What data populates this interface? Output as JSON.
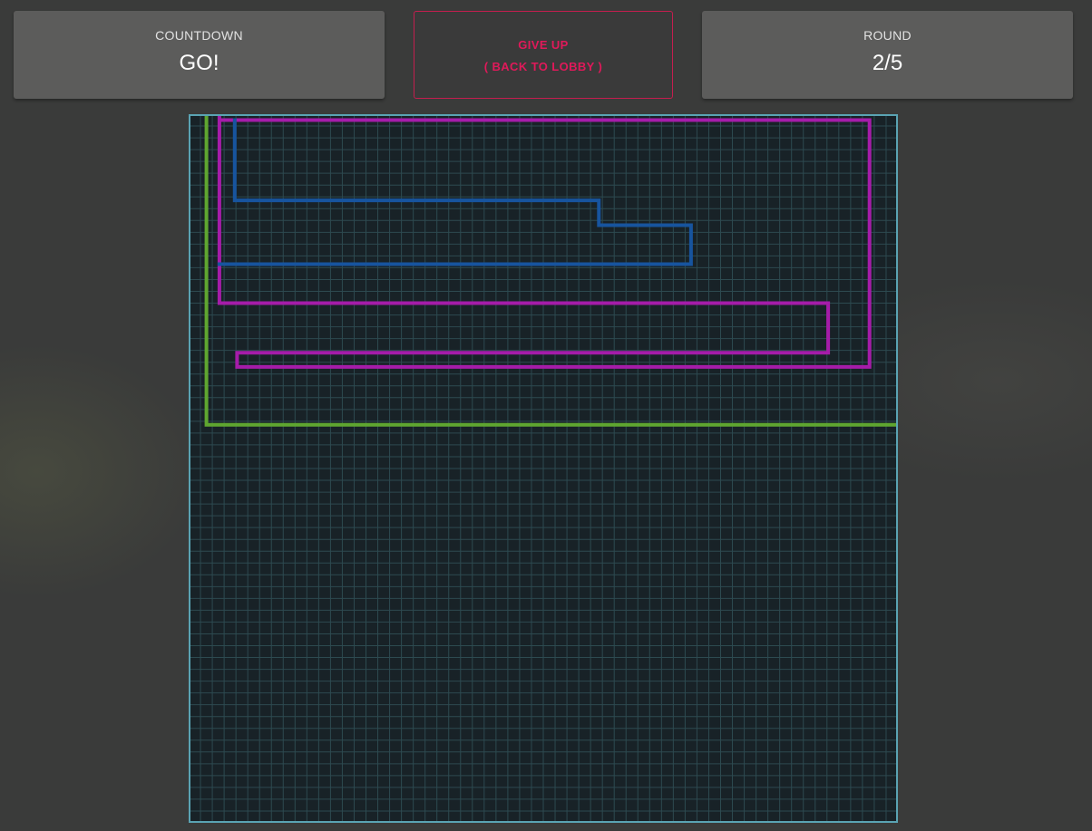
{
  "header": {
    "countdown": {
      "label": "COUNTDOWN",
      "value": "GO!"
    },
    "give_up": {
      "line1": "GIVE UP",
      "line2": "( BACK TO LOBBY )"
    },
    "round": {
      "label": "ROUND",
      "value": "2/5"
    }
  },
  "arena": {
    "grid_cells": 60,
    "colors": {
      "board": "#182227",
      "grid_line": "#2d4a50",
      "border": "#5aa3b3"
    },
    "trails": [
      {
        "player": "green",
        "color": "#5fa630",
        "cells": [
          [
            1.5,
            0.3
          ],
          [
            1.5,
            26.3
          ],
          [
            60.0,
            26.3
          ]
        ]
      },
      {
        "player": "magenta",
        "color": "#a51ca9",
        "cells": [
          [
            2.6,
            0.3
          ],
          [
            2.6,
            16.0
          ],
          [
            54.1,
            16.0
          ],
          [
            54.1,
            20.2
          ],
          [
            4.1,
            20.2
          ],
          [
            4.1,
            21.4
          ],
          [
            57.6,
            21.4
          ],
          [
            57.6,
            0.5
          ],
          [
            2.6,
            0.5
          ]
        ]
      },
      {
        "player": "blue",
        "color": "#17549e",
        "cells": [
          [
            3.9,
            0.5
          ],
          [
            3.9,
            7.3
          ],
          [
            34.7,
            7.3
          ],
          [
            34.7,
            9.4
          ],
          [
            42.5,
            9.4
          ],
          [
            42.5,
            12.7
          ],
          [
            2.6,
            12.7
          ]
        ]
      }
    ]
  }
}
